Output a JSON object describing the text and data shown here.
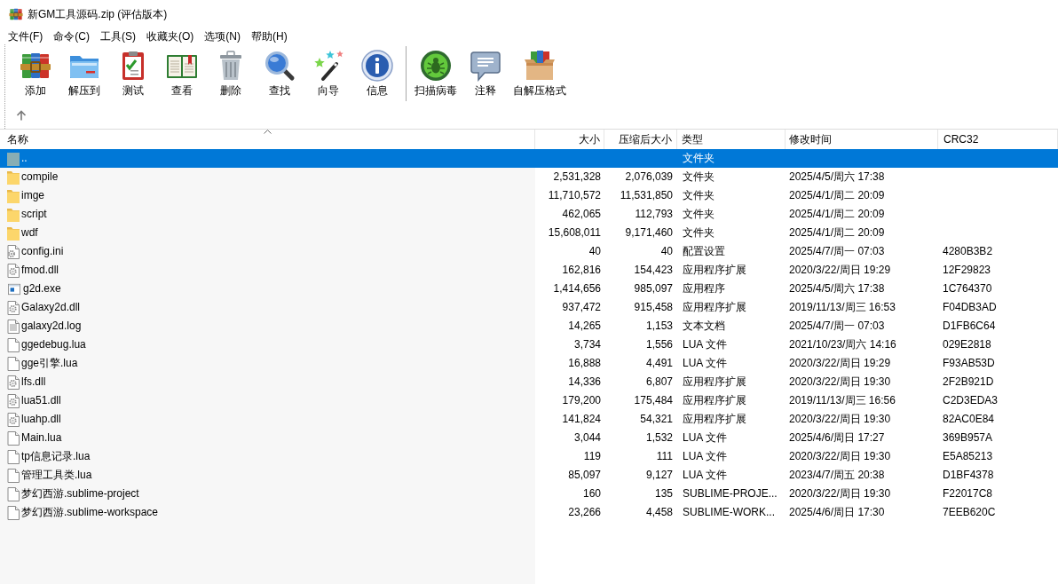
{
  "window": {
    "title": "新GM工具源码.zip (评估版本)"
  },
  "menu": [
    "文件(F)",
    "命令(C)",
    "工具(S)",
    "收藏夹(O)",
    "选项(N)",
    "帮助(H)"
  ],
  "toolbar": {
    "groups": [
      {
        "buttons": [
          {
            "label": "添加",
            "kind": "add"
          },
          {
            "label": "解压到",
            "kind": "extract"
          },
          {
            "label": "测试",
            "kind": "test"
          },
          {
            "label": "查看",
            "kind": "view"
          },
          {
            "label": "删除",
            "kind": "delete"
          },
          {
            "label": "查找",
            "kind": "find"
          },
          {
            "label": "向导",
            "kind": "wizard"
          },
          {
            "label": "信息",
            "kind": "info"
          }
        ]
      },
      {
        "buttons": [
          {
            "label": "扫描病毒",
            "kind": "scan"
          },
          {
            "label": "注释",
            "kind": "comment"
          },
          {
            "label": "自解压格式",
            "kind": "sfx"
          }
        ]
      }
    ]
  },
  "table": {
    "columns": [
      {
        "label": "名称",
        "sorted": true
      },
      {
        "label": "大小",
        "sorted": false
      },
      {
        "label": "压缩后大小",
        "sorted": false
      },
      {
        "label": "类型",
        "sorted": false
      },
      {
        "label": "修改时间",
        "sorted": false
      },
      {
        "label": "CRC32",
        "sorted": false
      }
    ],
    "rows": [
      {
        "kind": "parent",
        "name": "..",
        "type": "文件夹",
        "selected": true
      },
      {
        "kind": "folder",
        "name": "compile",
        "size": "2,531,328",
        "packed": "2,076,039",
        "type": "文件夹",
        "modified": "2025/4/5/周六 17:38",
        "selected": false
      },
      {
        "kind": "folder",
        "name": "imge",
        "size": "11,710,572",
        "packed": "11,531,850",
        "type": "文件夹",
        "modified": "2025/4/1/周二 20:09",
        "selected": false
      },
      {
        "kind": "folder",
        "name": "script",
        "size": "462,065",
        "packed": "112,793",
        "type": "文件夹",
        "modified": "2025/4/1/周二 20:09",
        "selected": false
      },
      {
        "kind": "folder",
        "name": "wdf",
        "size": "15,608,011",
        "packed": "9,171,460",
        "type": "文件夹",
        "modified": "2025/4/1/周二 20:09",
        "selected": false
      },
      {
        "kind": "config",
        "name": "config.ini",
        "size": "40",
        "packed": "40",
        "type": "配置设置",
        "modified": "2025/4/7/周一 07:03",
        "crc": "4280B3B2",
        "selected": false
      },
      {
        "kind": "library",
        "name": "fmod.dll",
        "size": "162,816",
        "packed": "154,423",
        "type": "应用程序扩展",
        "modified": "2020/3/22/周日 19:29",
        "crc": "12F29823",
        "selected": false
      },
      {
        "kind": "program",
        "name": "g2d.exe",
        "size": "1,414,656",
        "packed": "985,097",
        "type": "应用程序",
        "modified": "2025/4/5/周六 17:38",
        "crc": "1C764370",
        "selected": false
      },
      {
        "kind": "library",
        "name": "Galaxy2d.dll",
        "size": "937,472",
        "packed": "915,458",
        "type": "应用程序扩展",
        "modified": "2019/11/13/周三 16:53",
        "crc": "F04DB3AD",
        "selected": false
      },
      {
        "kind": "text",
        "name": "galaxy2d.log",
        "size": "14,265",
        "packed": "1,153",
        "type": "文本文档",
        "modified": "2025/4/7/周一 07:03",
        "crc": "D1FB6C64",
        "selected": false
      },
      {
        "kind": "file",
        "name": "ggedebug.lua",
        "size": "3,734",
        "packed": "1,556",
        "type": "LUA 文件",
        "modified": "2021/10/23/周六 14:16",
        "crc": "029E2818",
        "selected": false
      },
      {
        "kind": "file",
        "name": "gge引擎.lua",
        "size": "16,888",
        "packed": "4,491",
        "type": "LUA 文件",
        "modified": "2020/3/22/周日 19:29",
        "crc": "F93AB53D",
        "selected": false
      },
      {
        "kind": "library",
        "name": "lfs.dll",
        "size": "14,336",
        "packed": "6,807",
        "type": "应用程序扩展",
        "modified": "2020/3/22/周日 19:30",
        "crc": "2F2B921D",
        "selected": false
      },
      {
        "kind": "library",
        "name": "lua51.dll",
        "size": "179,200",
        "packed": "175,484",
        "type": "应用程序扩展",
        "modified": "2019/11/13/周三 16:56",
        "crc": "C2D3EDA3",
        "selected": false
      },
      {
        "kind": "library",
        "name": "luahp.dll",
        "size": "141,824",
        "packed": "54,321",
        "type": "应用程序扩展",
        "modified": "2020/3/22/周日 19:30",
        "crc": "82AC0E84",
        "selected": false
      },
      {
        "kind": "file",
        "name": "Main.lua",
        "size": "3,044",
        "packed": "1,532",
        "type": "LUA 文件",
        "modified": "2025/4/6/周日 17:27",
        "crc": "369B957A",
        "selected": false
      },
      {
        "kind": "file",
        "name": "tp信息记录.lua",
        "size": "119",
        "packed": "111",
        "type": "LUA 文件",
        "modified": "2020/3/22/周日 19:30",
        "crc": "E5A85213",
        "selected": false
      },
      {
        "kind": "file",
        "name": "管理工具类.lua",
        "size": "85,097",
        "packed": "9,127",
        "type": "LUA 文件",
        "modified": "2023/4/7/周五 20:38",
        "crc": "D1BF4378",
        "selected": false
      },
      {
        "kind": "file",
        "name": "梦幻西游.sublime-project",
        "size": "160",
        "packed": "135",
        "type": "SUBLIME-PROJE...",
        "modified": "2020/3/22/周日 19:30",
        "crc": "F22017C8",
        "selected": false
      },
      {
        "kind": "file",
        "name": "梦幻西游.sublime-workspace",
        "size": "23,266",
        "packed": "4,458",
        "type": "SUBLIME-WORK...",
        "modified": "2025/4/6/周日 17:30",
        "crc": "7EEB620C",
        "selected": false
      }
    ]
  }
}
